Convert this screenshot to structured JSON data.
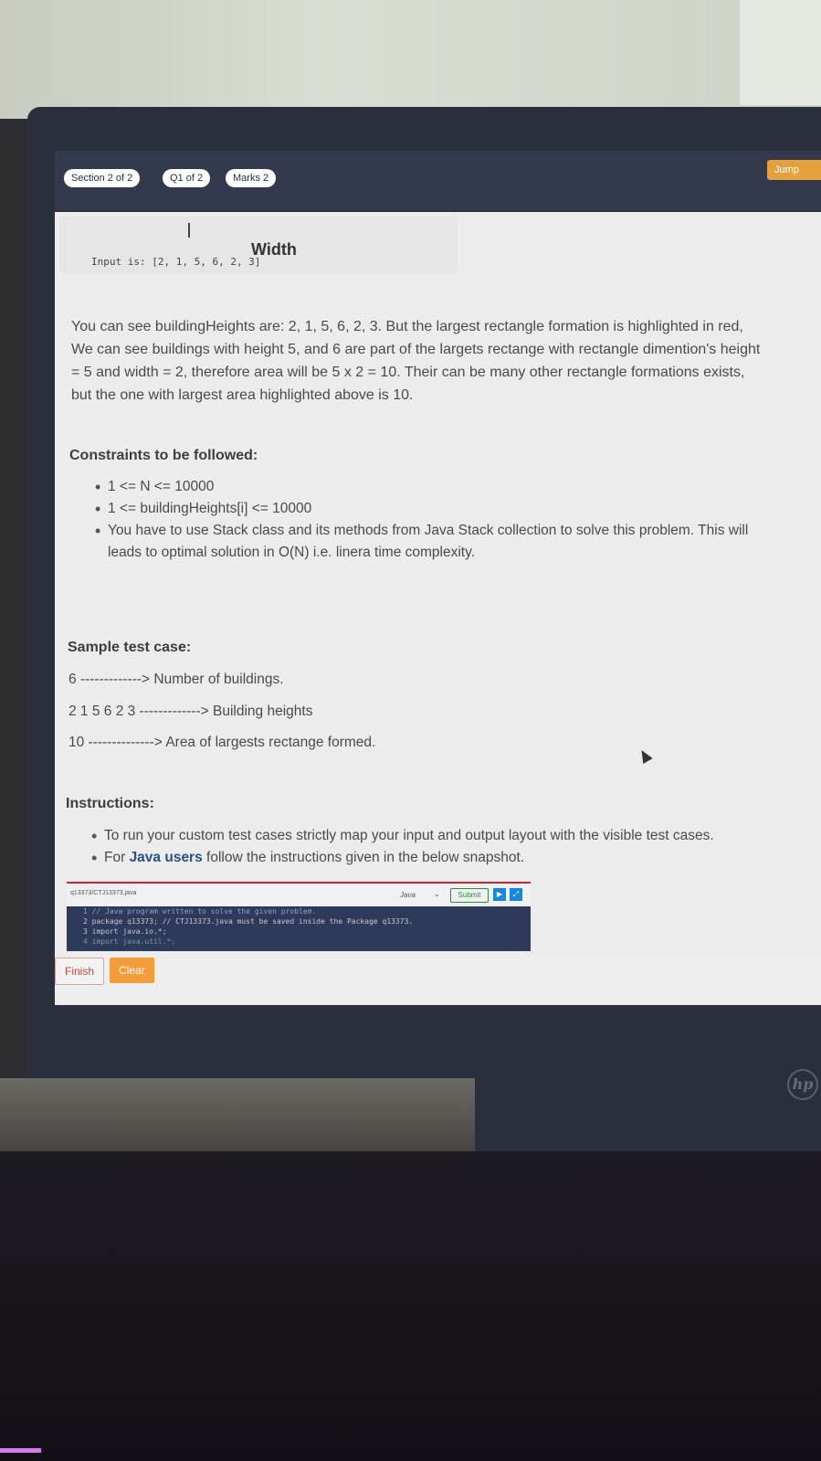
{
  "header": {
    "section": "Section 2 of 2",
    "question": "Q1 of 2",
    "marks": "Marks 2",
    "jump": "Jump"
  },
  "figure": {
    "width_label": "Width",
    "input_label": "Input is: [2, 1, 5, 6, 2, 3]"
  },
  "description": "You can see buildingHeights are: 2, 1, 5, 6, 2, 3. But the largest rectangle formation is highlighted in red, We can see buildings with height 5, and 6 are part of the largets rectange with rectangle dimention's height = 5 and width = 2, therefore area will be 5 x 2 = 10. Their can be many other rectangle formations exists, but the one with largest area highlighted above is 10.",
  "constraints": {
    "heading": "Constraints to be followed:",
    "items": [
      "1 <= N <= 10000",
      "1 <= buildingHeights[i] <= 10000",
      "You have to use Stack class and its methods from Java Stack collection to solve this problem. This will leads to optimal solution in O(N) i.e. linera time complexity."
    ]
  },
  "sample": {
    "heading": "Sample test case:",
    "lines": [
      "6 -------------> Number of buildings.",
      "2 1 5 6 2 3 -------------> Building heights",
      "10 --------------> Area of largests rectange formed."
    ]
  },
  "instructions": {
    "heading": "Instructions:",
    "item1": "To run your custom test cases strictly map your input and output layout with the visible test cases.",
    "item2_pre": "For ",
    "item2_bold": "Java users",
    "item2_post": " follow the instructions given in the below snapshot."
  },
  "snapshot": {
    "file": "q13373/CTJ13373.java",
    "lang": "Java",
    "submit": "Submit",
    "code_lines": [
      "1  // Java program written to solve the given problem.",
      "2  package q13373; // CTJ13373.java must be saved inside the Package q13373.",
      "3  import java.io.*;",
      "4  import java.util.*;"
    ]
  },
  "footer": {
    "finish": "Finish",
    "clear": "Clear"
  },
  "brand": "hp"
}
